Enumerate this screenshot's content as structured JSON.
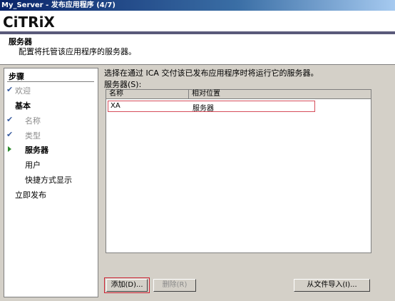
{
  "window": {
    "title": "My_Server - 发布应用程序 (4/7)"
  },
  "brand": {
    "logo": "CiTRiX"
  },
  "header": {
    "title": "服务器",
    "subtitle": "配置将托管该应用程序的服务器。"
  },
  "steps": {
    "title": "步骤",
    "items": [
      {
        "label": "欢迎",
        "state": "done"
      },
      {
        "label": "基本",
        "state": "section"
      },
      {
        "label": "名称",
        "state": "done"
      },
      {
        "label": "类型",
        "state": "done"
      },
      {
        "label": "服务器",
        "state": "current"
      },
      {
        "label": "用户",
        "state": "pending"
      },
      {
        "label": "快捷方式显示",
        "state": "pending"
      },
      {
        "label": "立即发布",
        "state": "section-pending"
      }
    ]
  },
  "main": {
    "prompt": "选择在通过 ICA 交付该已发布应用程序时将运行它的服务器。",
    "servers_label": "服务器(S):",
    "columns": [
      "名称",
      "相对位置"
    ],
    "rows": [
      {
        "name": "XA",
        "location": "服务器"
      }
    ]
  },
  "buttons": {
    "add": "添加(D)...",
    "remove": "删除(R)",
    "import": "从文件导入(I)..."
  },
  "colors": {
    "focus_border": "#cc2030",
    "check": "#3a5da0",
    "current_arrow": "#2e8b2e"
  }
}
